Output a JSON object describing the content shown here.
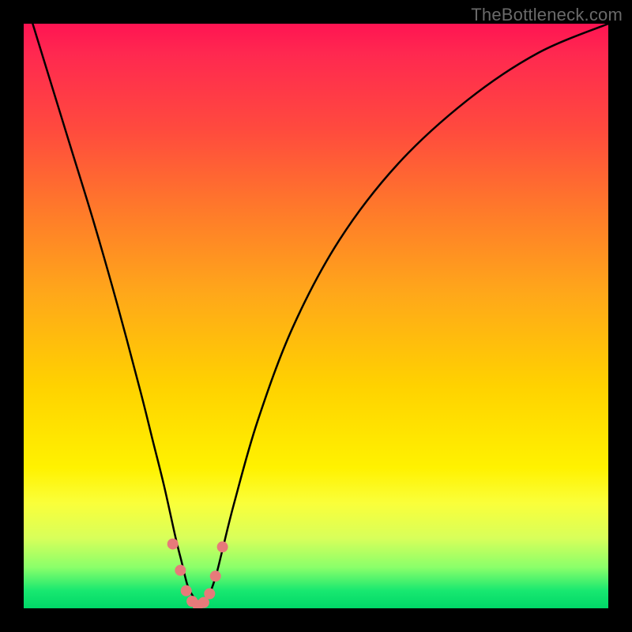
{
  "watermark": "TheBottleneck.com",
  "chart_data": {
    "type": "line",
    "title": "",
    "xlabel": "",
    "ylabel": "",
    "xlim": [
      0,
      100
    ],
    "ylim": [
      0,
      100
    ],
    "series": [
      {
        "name": "curve",
        "x": [
          0,
          4,
          8,
          12,
          16,
          20,
          22,
          24,
          26,
          27,
          28,
          29,
          30,
          31,
          32,
          33,
          34,
          36,
          40,
          46,
          54,
          64,
          76,
          88,
          100
        ],
        "values": [
          105,
          92,
          79,
          66,
          52,
          37,
          29,
          21,
          12,
          8,
          4,
          2,
          1,
          1.5,
          3,
          6,
          10,
          18,
          32,
          48,
          63,
          76,
          87,
          95,
          100
        ]
      }
    ],
    "markers": {
      "name": "points",
      "color": "#e77a7a",
      "x": [
        25.5,
        26.8,
        27.8,
        28.8,
        29.8,
        30.8,
        31.8,
        32.8,
        34.0
      ],
      "values": [
        11.0,
        6.5,
        3.0,
        1.2,
        0.5,
        1.0,
        2.5,
        5.5,
        10.5
      ]
    },
    "background_gradient": {
      "top": "#ff1452",
      "mid": "#ffd200",
      "bottom": "#00d768"
    }
  }
}
